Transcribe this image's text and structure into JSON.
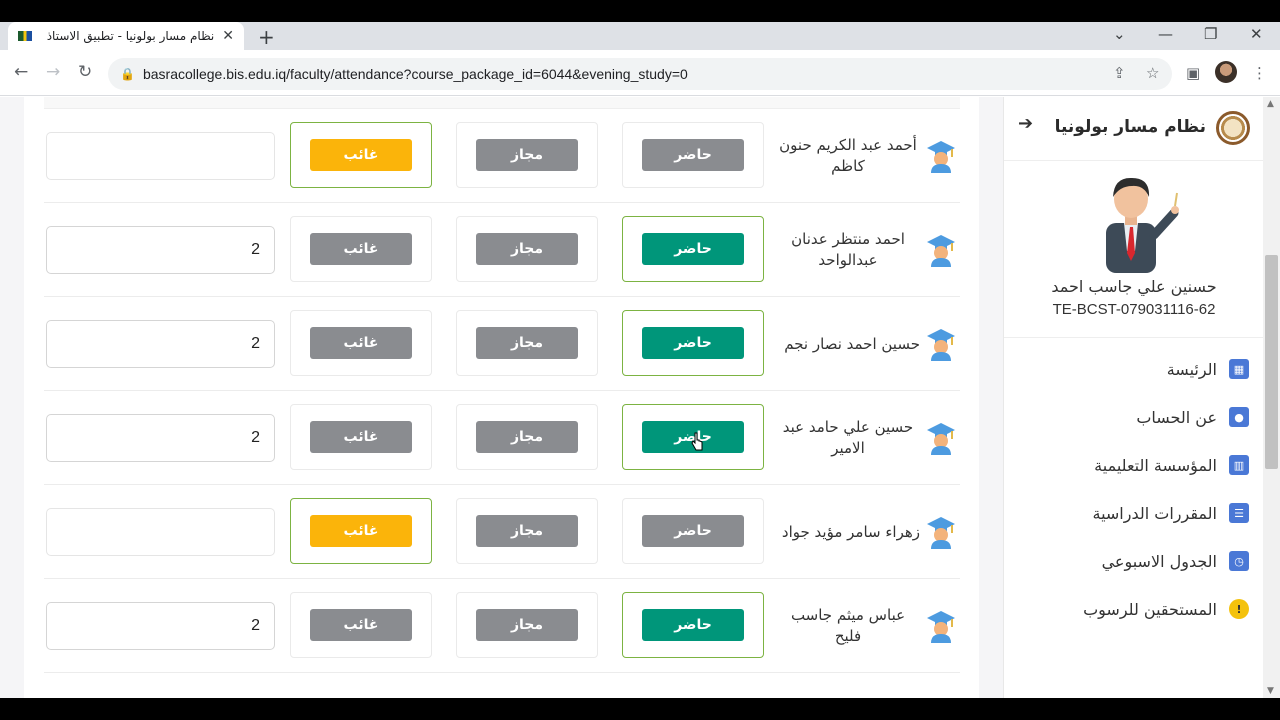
{
  "browser": {
    "tab_title": "نظام مسار بولونيا - تطبيق الاستاذ",
    "tab_close": "✕",
    "new_tab": "+",
    "url": "basracollege.bis.edu.iq/faculty/attendance?course_package_id=6044&evening_study=0"
  },
  "sidebar": {
    "brand_title": "نظام مسار بولونيا",
    "user_name": "حسنين علي جاسب احمد",
    "user_id": "TE-BCST-079031116-62",
    "menu": [
      {
        "label": "الرئيسة",
        "icon": "dashboard-icon"
      },
      {
        "label": "عن الحساب",
        "icon": "account-icon"
      },
      {
        "label": "المؤسسة التعليمية",
        "icon": "building-icon"
      },
      {
        "label": "المقررات الدراسية",
        "icon": "list-icon"
      },
      {
        "label": "الجدول الاسبوعي",
        "icon": "calendar-clock-icon"
      },
      {
        "label": "المستحقين للرسوب",
        "icon": "warning-icon"
      }
    ]
  },
  "attendance": {
    "labels": {
      "present": "حاضر",
      "excused": "مجاز",
      "absent": "غائب"
    },
    "rows": [
      {
        "name": "أحمد عبد الكريم حنون كاظم",
        "status": "absent",
        "hours": ""
      },
      {
        "name": "احمد منتظر عدنان عبدالواحد",
        "status": "present",
        "hours": "2"
      },
      {
        "name": "حسين احمد نصار نجم",
        "status": "present",
        "hours": "2"
      },
      {
        "name": "حسين علي حامد عبد الامير",
        "status": "present",
        "hours": "2"
      },
      {
        "name": "زهراء سامر مؤيد جواد",
        "status": "absent",
        "hours": ""
      },
      {
        "name": "عباس ميثم جاسب فليح",
        "status": "present",
        "hours": "2"
      }
    ]
  },
  "colors": {
    "present": "#00967a",
    "absent": "#fbb40a",
    "neutral": "#8a8c90",
    "selected_border": "#7cb342"
  }
}
